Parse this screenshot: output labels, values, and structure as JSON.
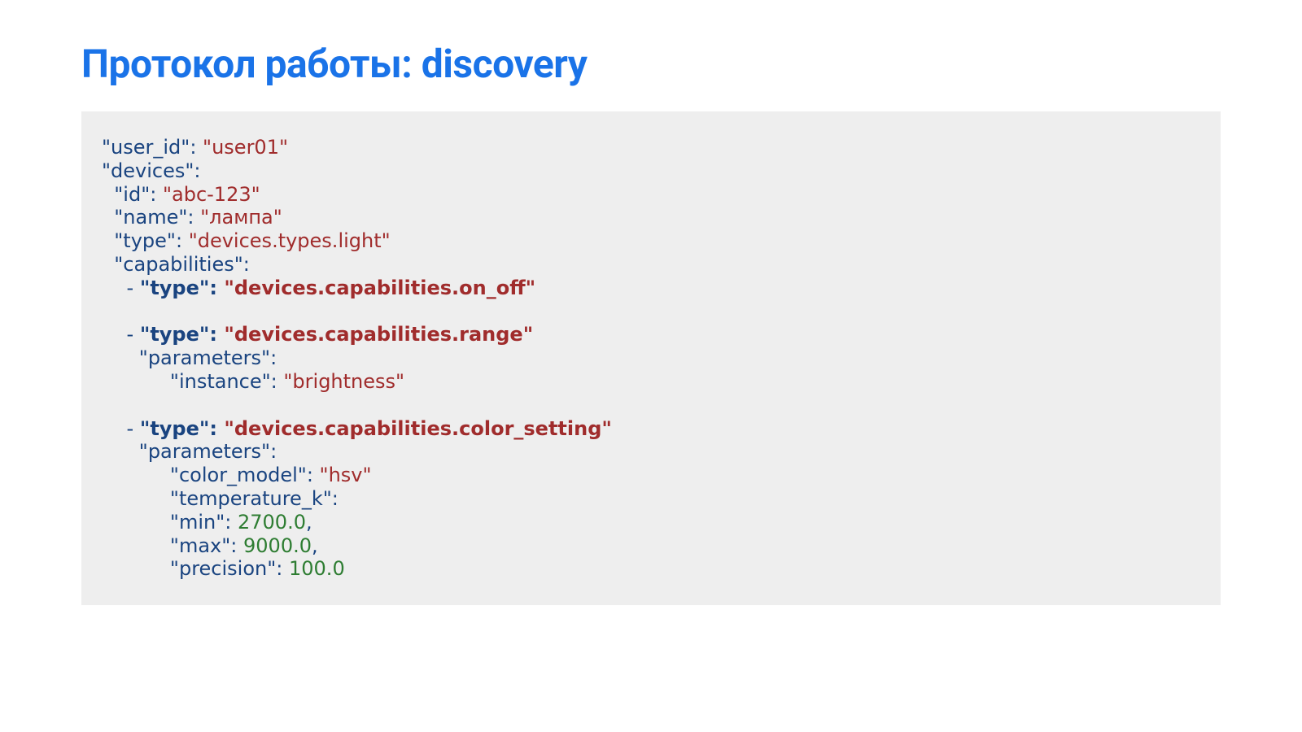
{
  "title": "Протокол работы: discovery",
  "k": {
    "user_id": "\"user_id\"",
    "devices": "\"devices\"",
    "id": "\"id\"",
    "name": "\"name\"",
    "type": "\"type\"",
    "capabilities": "\"capabilities\"",
    "parameters": "\"parameters\"",
    "instance": "\"instance\"",
    "color_model": "\"color_model\"",
    "temperature_k": "\"temperature_k\"",
    "min": "\"min\"",
    "max": "\"max\"",
    "precision": "\"precision\""
  },
  "v": {
    "user01": "\"user01\"",
    "abc123": "\"abc-123\"",
    "lampa": "\"лампа\"",
    "dev_light": "\"devices.types.light\"",
    "cap_on_off": "\"devices.capabilities.on_off\"",
    "cap_range": "\"devices.capabilities.range\"",
    "brightness": "\"brightness\"",
    "cap_color": "\"devices.capabilities.color_setting\"",
    "hsv": "\"hsv\"",
    "n2700": "2700.0",
    "n9000": "9000.0",
    "n100": "100.0"
  },
  "p": {
    "colon_sp": ": ",
    "colon": ":",
    "dash_sp": "- ",
    "comma": ","
  }
}
